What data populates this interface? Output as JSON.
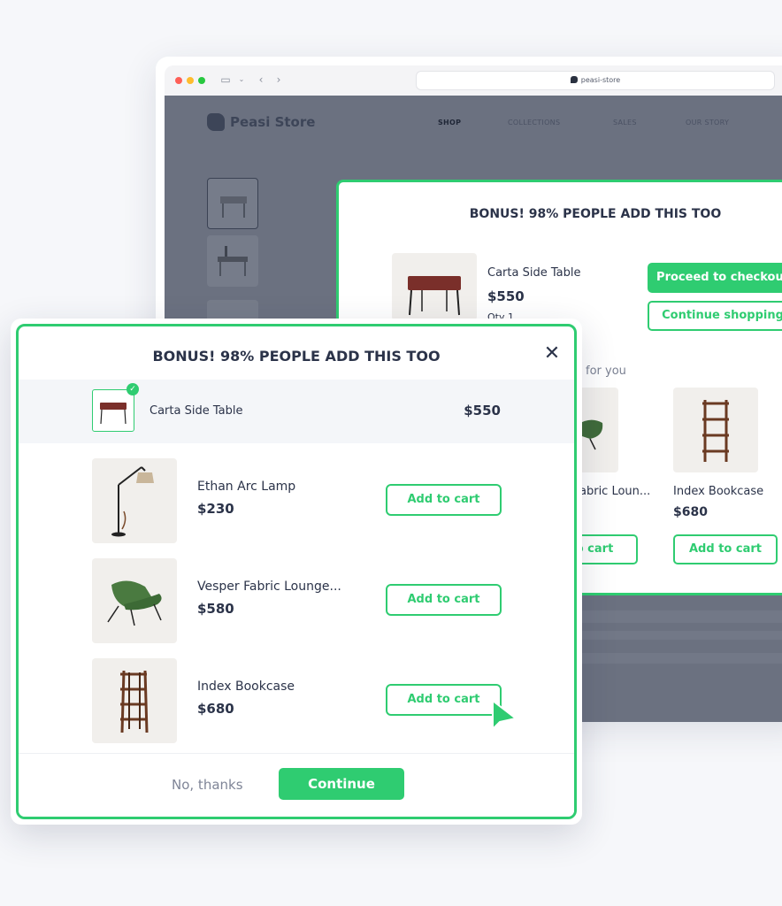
{
  "browser": {
    "url": "peasi-store",
    "store_name": "Peasi Store",
    "nav": [
      "SHOP",
      "COLLECTIONS",
      "SALES",
      "OUR STORY"
    ]
  },
  "back_modal": {
    "title": "BONUS! 98% PEOPLE ADD THIS TOO",
    "product": {
      "name": "Carta Side Table",
      "price": "$550",
      "qty": "Qty 1"
    },
    "checkout_label": "Proceed to checkout",
    "continue_label": "Continue shopping",
    "section_label": "for you",
    "items": [
      {
        "name": "abric Loun...",
        "button": "o cart"
      },
      {
        "name": "Index Bookcase",
        "price": "$680",
        "button": "Add to cart"
      }
    ]
  },
  "front_modal": {
    "title": "BONUS! 98% PEOPLE ADD THIS TOO",
    "close_icon": "close-icon",
    "selected": {
      "name": "Carta Side Table",
      "price": "$550"
    },
    "items": [
      {
        "name": "Ethan Arc Lamp",
        "price": "$230",
        "button": "Add to cart",
        "icon": "floor-lamp"
      },
      {
        "name": "Vesper Fabric Lounge...",
        "price": "$580",
        "button": "Add to cart",
        "icon": "lounge-chair"
      },
      {
        "name": "Index Bookcase",
        "price": "$680",
        "button": "Add to cart",
        "icon": "bookcase"
      }
    ],
    "no_thanks": "No, thanks",
    "continue": "Continue"
  },
  "colors": {
    "accent": "#2fcc71",
    "text": "#2b3349"
  }
}
